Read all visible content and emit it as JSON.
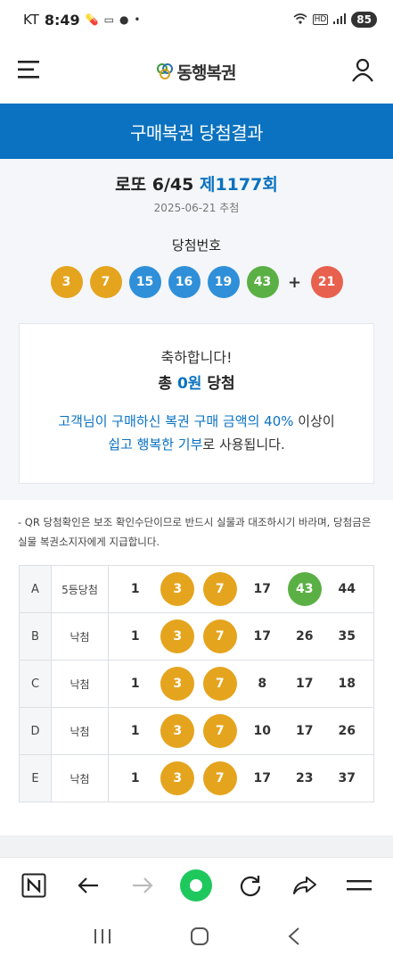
{
  "status": {
    "carrier": "KT",
    "time": "8:49",
    "battery": "85",
    "hd": "HD"
  },
  "header": {
    "logo_text": "동행복권"
  },
  "title_band": "구매복권 당첨결과",
  "game": {
    "name": "로또 6/45",
    "round": "제1177회",
    "date": "2025-06-21 추첨"
  },
  "winning": {
    "label": "당첨번호",
    "numbers": [
      "3",
      "7",
      "15",
      "16",
      "19",
      "43"
    ],
    "plus": "+",
    "bonus": "21"
  },
  "card": {
    "congrats": "축하합니다!",
    "total_prefix": "총",
    "total_amount": "0원",
    "total_suffix": "당첨",
    "msg_part1": "고객님이 구매하신 복권 구매 금액의 40%",
    "msg_part2": " 이상이",
    "msg_part3": "쉽고 행복한 기부",
    "msg_part4": "로 사용됩니다."
  },
  "notice": "- QR 당첨확인은 보조 확인수단이므로 반드시 실물과 대조하시기 바라며, 당첨금은 실물 복권소지자에게 지급합니다.",
  "tickets": [
    {
      "line": "A",
      "result": "5등당첨",
      "n": [
        "1",
        "3",
        "7",
        "17",
        "43",
        "44"
      ]
    },
    {
      "line": "B",
      "result": "낙첨",
      "n": [
        "1",
        "3",
        "7",
        "17",
        "26",
        "35"
      ]
    },
    {
      "line": "C",
      "result": "낙첨",
      "n": [
        "1",
        "3",
        "7",
        "8",
        "17",
        "18"
      ]
    },
    {
      "line": "D",
      "result": "낙첨",
      "n": [
        "1",
        "3",
        "7",
        "10",
        "17",
        "26"
      ]
    },
    {
      "line": "E",
      "result": "낙첨",
      "n": [
        "1",
        "3",
        "7",
        "17",
        "23",
        "37"
      ]
    }
  ],
  "colors": {
    "brand_blue": "#0a72c0",
    "ball_yellow": "#e5a41e",
    "ball_blue": "#2f8fd8",
    "ball_green": "#5bb045",
    "ball_red": "#e8614e"
  }
}
